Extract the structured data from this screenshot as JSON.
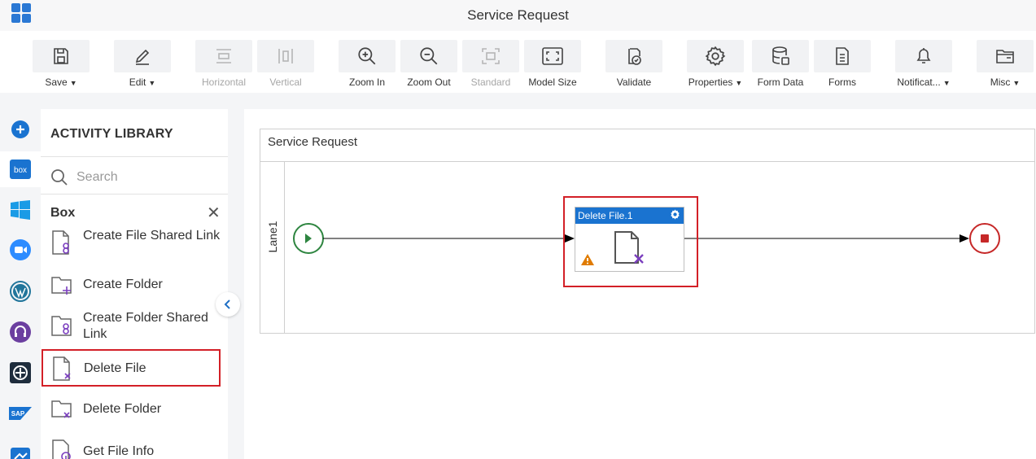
{
  "app": {
    "title": "Service Request"
  },
  "toolbar": {
    "buttons": [
      {
        "label": "Save",
        "icon": "save-icon",
        "dropdown": true,
        "disabled": false
      },
      {
        "label": "Edit",
        "icon": "edit-icon",
        "dropdown": true,
        "disabled": false
      },
      {
        "label": "Horizontal",
        "icon": "horizontal-icon",
        "dropdown": false,
        "disabled": true
      },
      {
        "label": "Vertical",
        "icon": "vertical-icon",
        "dropdown": false,
        "disabled": true
      },
      {
        "label": "Zoom In",
        "icon": "zoom-in-icon",
        "dropdown": false,
        "disabled": false
      },
      {
        "label": "Zoom Out",
        "icon": "zoom-out-icon",
        "dropdown": false,
        "disabled": false
      },
      {
        "label": "Standard",
        "icon": "standard-icon",
        "dropdown": false,
        "disabled": true
      },
      {
        "label": "Model Size",
        "icon": "model-size-icon",
        "dropdown": false,
        "disabled": false
      },
      {
        "label": "Validate",
        "icon": "validate-icon",
        "dropdown": false,
        "disabled": false
      },
      {
        "label": "Properties",
        "icon": "gear-icon",
        "dropdown": true,
        "disabled": false
      },
      {
        "label": "Form Data",
        "icon": "database-icon",
        "dropdown": false,
        "disabled": false
      },
      {
        "label": "Forms",
        "icon": "forms-icon",
        "dropdown": false,
        "disabled": false
      },
      {
        "label": "Notificat...",
        "icon": "bell-icon",
        "dropdown": true,
        "disabled": false
      },
      {
        "label": "Misc",
        "icon": "folder-icon",
        "dropdown": true,
        "disabled": false
      }
    ]
  },
  "rail": {
    "items": [
      "add-icon",
      "box-icon",
      "windows-icon",
      "zoom-app-icon",
      "wordpress-icon",
      "support-icon",
      "target-icon",
      "sap-icon",
      "flow-icon"
    ],
    "box_text": "box",
    "sap_text": "SAP"
  },
  "library": {
    "title": "ACTIVITY LIBRARY",
    "search_placeholder": "Search",
    "section": "Box",
    "items": [
      {
        "label": "Create File Shared Link",
        "icon": "file-link-icon"
      },
      {
        "label": "Create Folder",
        "icon": "folder-add-icon"
      },
      {
        "label": "Create Folder Shared Link",
        "icon": "folder-link-icon"
      },
      {
        "label": "Delete File",
        "icon": "file-delete-icon",
        "selected": true
      },
      {
        "label": "Delete Folder",
        "icon": "folder-delete-icon"
      },
      {
        "label": "Get File Info",
        "icon": "file-info-icon"
      }
    ]
  },
  "canvas": {
    "pool_title": "Service Request",
    "lane_label": "Lane1",
    "task": {
      "label": "Delete File.1",
      "warning": true
    }
  },
  "colors": {
    "accent": "#1a73d0",
    "highlight": "#d32027",
    "start": "#2e8540",
    "end": "#c62828",
    "purple": "#7b3fbf"
  }
}
